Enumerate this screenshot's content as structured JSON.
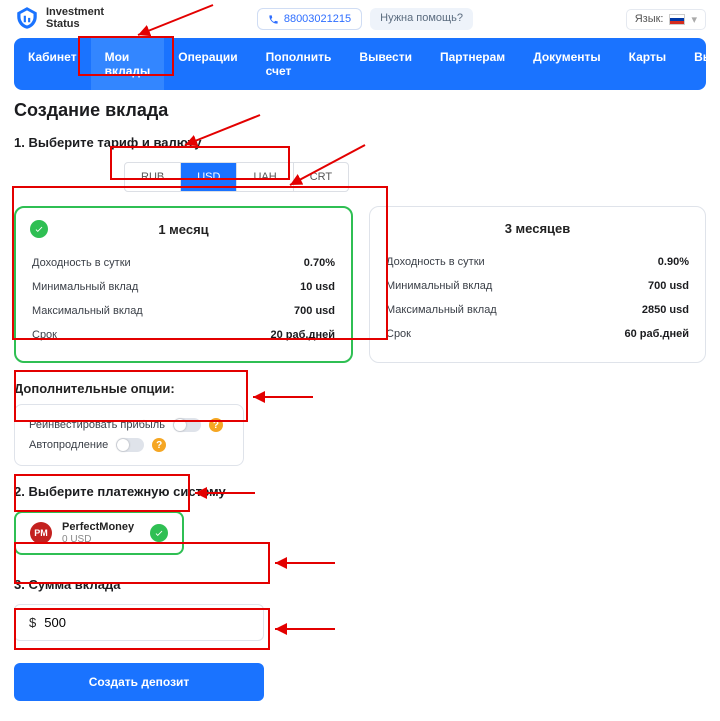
{
  "brand": {
    "line1": "Investment",
    "line2": "Status"
  },
  "header": {
    "phone": "88003021215",
    "help_label": "Нужна помощь?",
    "lang_label": "Язык:"
  },
  "nav": {
    "items": [
      "Кабинет",
      "Мои вклады",
      "Операции",
      "Пополнить счет",
      "Вывести",
      "Партнерам",
      "Документы",
      "Карты",
      "Выход"
    ],
    "active_index": 1
  },
  "page_title": "Создание вклада",
  "step1_heading": "1. Выберите тариф и валюту",
  "currency_tabs": {
    "items": [
      "RUB",
      "USD",
      "UAH",
      "CRT"
    ],
    "active_index": 1
  },
  "plans": [
    {
      "title": "1 месяц",
      "selected": true,
      "rows": {
        "daily_label": "Доходность в сутки",
        "daily_value": "0.70%",
        "min_label": "Минимальный вклад",
        "min_value": "10 usd",
        "max_label": "Максимальный вклад",
        "max_value": "700 usd",
        "term_label": "Срок",
        "term_value": "20 раб.дней"
      }
    },
    {
      "title": "3 месяцев",
      "selected": false,
      "rows": {
        "daily_label": "Доходность в сутки",
        "daily_value": "0.90%",
        "min_label": "Минимальный вклад",
        "min_value": "700 usd",
        "max_label": "Максимальный вклад",
        "max_value": "2850 usd",
        "term_label": "Срок",
        "term_value": "60 раб.дней"
      }
    }
  ],
  "options": {
    "heading": "Дополнительные опции:",
    "reinvest_label": "Реинвестировать прибыль",
    "autorenew_label": "Автопродление"
  },
  "step2_heading": "2. Выберите платежную систему",
  "paysys": {
    "logo_text": "PM",
    "name": "PerfectMoney",
    "balance": "0 USD"
  },
  "step3_heading": "3. Сумма вклада",
  "amount": {
    "currency_symbol": "$",
    "value": "500"
  },
  "create_button": "Создать депозит"
}
